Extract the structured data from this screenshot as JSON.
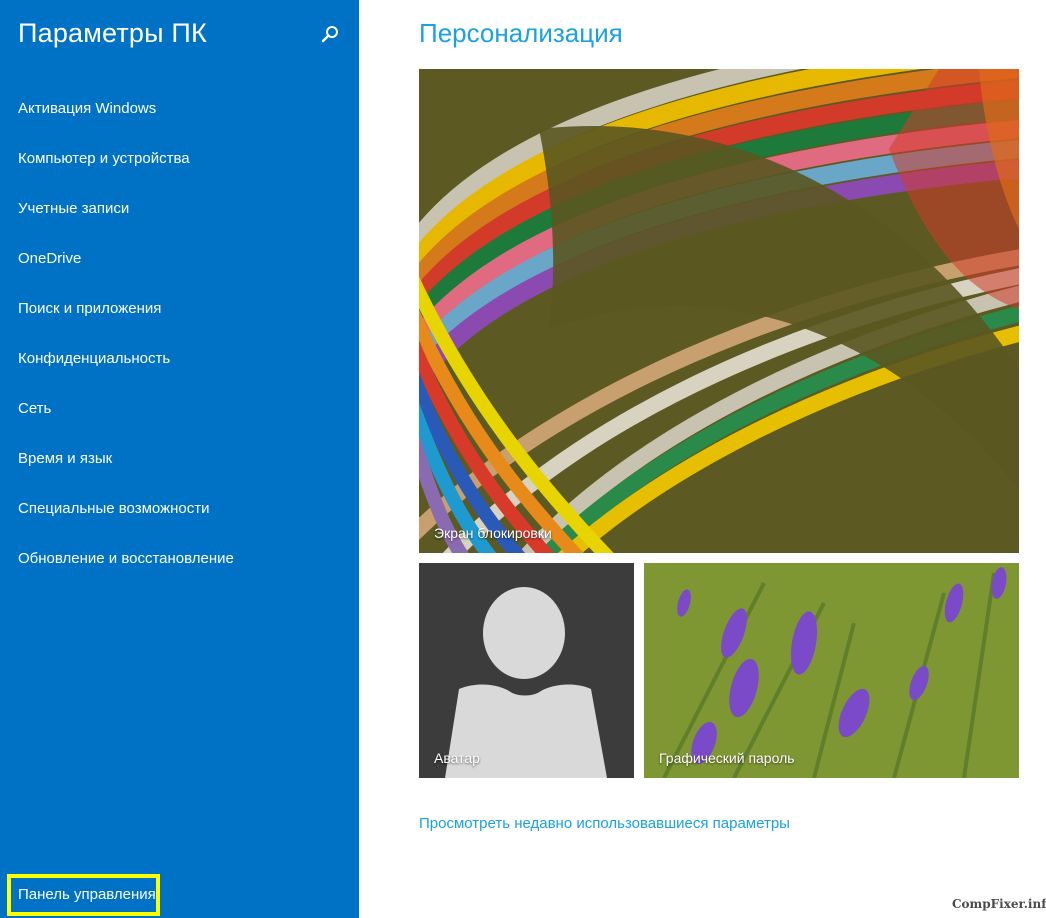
{
  "colors": {
    "sidebar_bg": "#0072c6",
    "accent": "#1ba1e2",
    "highlight_border": "#ffff00"
  },
  "sidebar": {
    "title": "Параметры ПК",
    "search_icon": "search-icon",
    "items": [
      {
        "label": "Активация Windows"
      },
      {
        "label": "Компьютер и устройства"
      },
      {
        "label": "Учетные записи"
      },
      {
        "label": "OneDrive"
      },
      {
        "label": "Поиск и приложения"
      },
      {
        "label": "Конфиденциальность"
      },
      {
        "label": "Сеть"
      },
      {
        "label": "Время и язык"
      },
      {
        "label": "Специальные возможности"
      },
      {
        "label": "Обновление и восстановление"
      }
    ],
    "control_panel_label": "Панель управления"
  },
  "main": {
    "title": "Персонализация",
    "tiles": {
      "lock_screen": "Экран блокировки",
      "avatar": "Аватар",
      "picture_password": "Графический пароль"
    },
    "recent_link": "Просмотреть недавно использовавшиеся параметры"
  },
  "watermark": "CompFixer.info"
}
